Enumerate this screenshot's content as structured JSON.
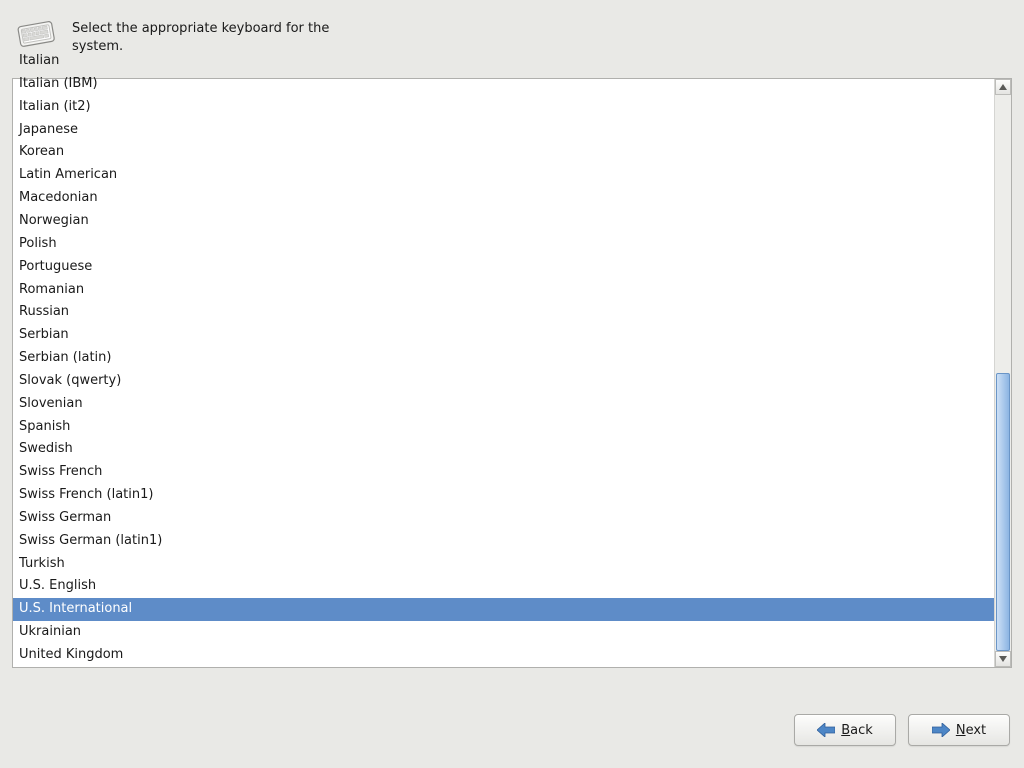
{
  "header": {
    "instruction": "Select the appropriate keyboard for the system."
  },
  "list": {
    "selected_index": 24,
    "items": [
      "Italian",
      "Italian (IBM)",
      "Italian (it2)",
      "Japanese",
      "Korean",
      "Latin American",
      "Macedonian",
      "Norwegian",
      "Polish",
      "Portuguese",
      "Romanian",
      "Russian",
      "Serbian",
      "Serbian (latin)",
      "Slovak (qwerty)",
      "Slovenian",
      "Spanish",
      "Swedish",
      "Swiss French",
      "Swiss French (latin1)",
      "Swiss German",
      "Swiss German (latin1)",
      "Turkish",
      "U.S. English",
      "U.S. International",
      "Ukrainian",
      "United Kingdom"
    ]
  },
  "scrollbar": {
    "thumb_top_percent": 50,
    "thumb_height_percent": 50
  },
  "buttons": {
    "back": {
      "accel": "B",
      "rest": "ack"
    },
    "next": {
      "accel": "N",
      "rest": "ext"
    }
  }
}
